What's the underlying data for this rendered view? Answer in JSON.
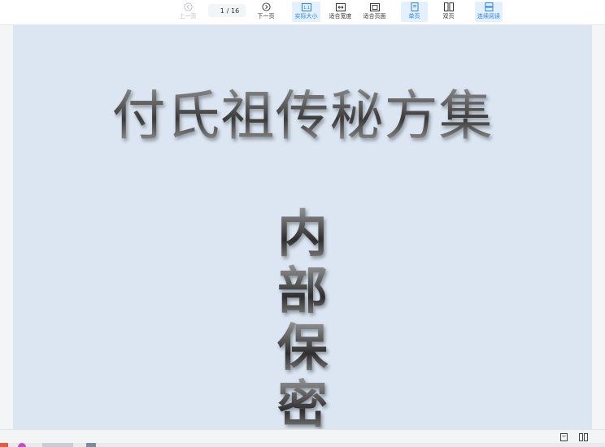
{
  "toolbar": {
    "prev_label": "上一页",
    "page_current": "1",
    "page_total": "/ 16",
    "next_label": "下一页",
    "actual_size_label": "实际大小",
    "fit_width_label": "适合宽度",
    "fit_page_label": "适合页面",
    "single_page_label": "单页",
    "double_page_label": "双页",
    "continuous_label": "连续阅读"
  },
  "document": {
    "title": "付氏祖传秘方集",
    "vertical_chars": [
      "内",
      "部",
      "保",
      "密"
    ]
  },
  "colors": {
    "accent": "#2f80ed",
    "active_bg": "#e3f0ff",
    "page_bg": "#dbe6f2"
  }
}
